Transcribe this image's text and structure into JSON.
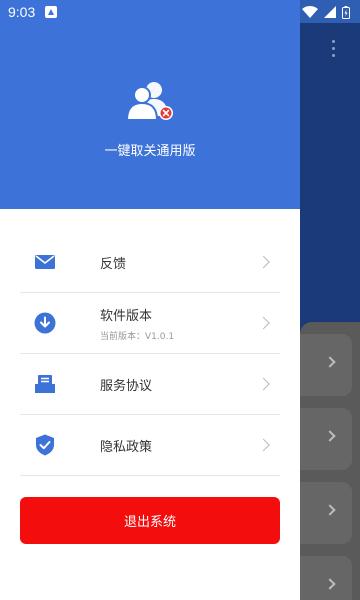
{
  "status_bar": {
    "time": "9:03",
    "icons": [
      "notification-a-icon",
      "wifi-icon",
      "signal-icon",
      "battery-icon"
    ]
  },
  "drawer": {
    "app_title": "一键取关通用版",
    "header_color": "#3d72d9",
    "menu": [
      {
        "icon": "mail-icon",
        "label": "反馈",
        "sub": ""
      },
      {
        "icon": "download-icon",
        "label": "软件版本",
        "sub": "当前版本：V1.0.1"
      },
      {
        "icon": "document-icon",
        "label": "服务协议",
        "sub": ""
      },
      {
        "icon": "shield-icon",
        "label": "隐私政策",
        "sub": ""
      }
    ],
    "logout_label": "退出系统",
    "logout_color": "#f30d0d"
  },
  "background_app": {
    "icons": [
      "more-vertical-icon",
      "chevron-right-icon"
    ]
  }
}
